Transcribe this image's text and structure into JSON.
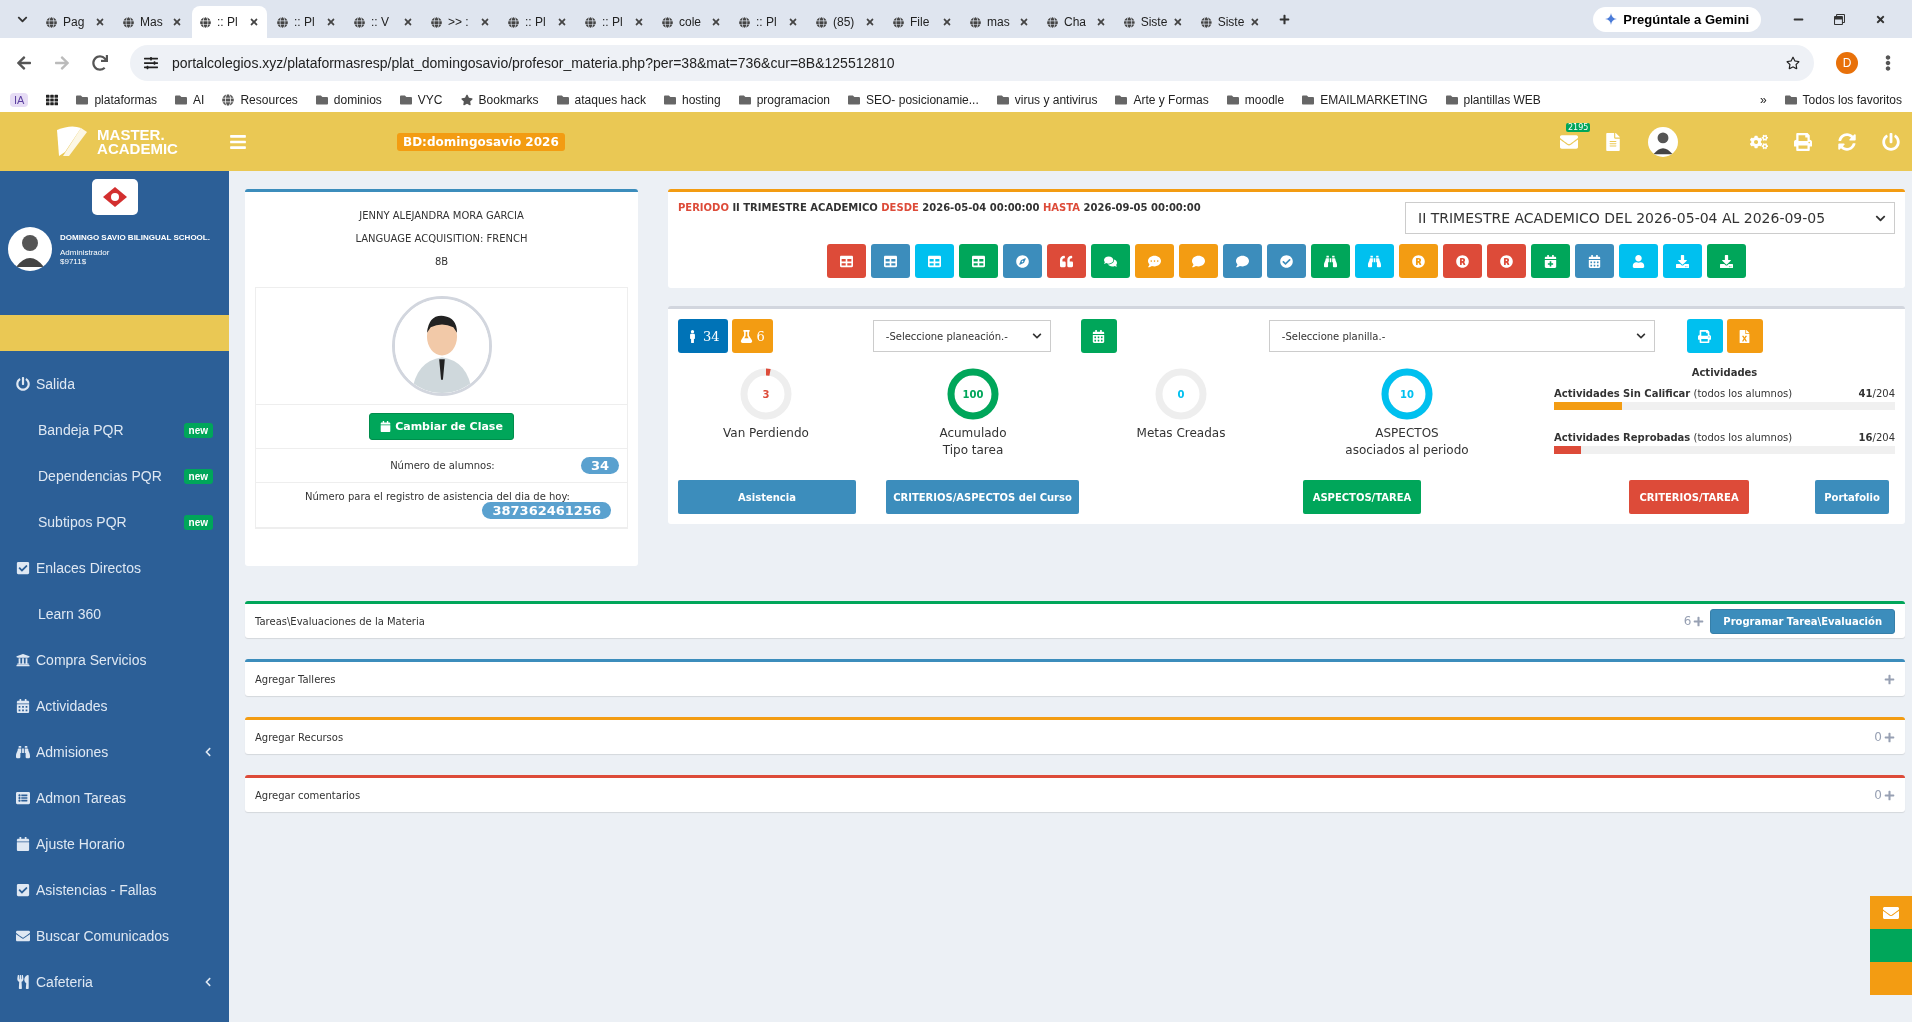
{
  "browser": {
    "tabs": [
      {
        "title": "Pag",
        "selected": false
      },
      {
        "title": "Mas",
        "selected": false
      },
      {
        "title": ":: Pl",
        "selected": true
      },
      {
        "title": ":: Pl",
        "selected": false
      },
      {
        "title": ":: V",
        "selected": false
      },
      {
        "title": ">> :",
        "selected": false
      },
      {
        "title": ":: Pl",
        "selected": false
      },
      {
        "title": ":: Pl",
        "selected": false
      },
      {
        "title": "cole",
        "selected": false
      },
      {
        "title": ":: Pl",
        "selected": false
      },
      {
        "title": "(85)",
        "selected": false
      },
      {
        "title": "File",
        "selected": false
      },
      {
        "title": "mas",
        "selected": false
      },
      {
        "title": "Cha",
        "selected": false
      },
      {
        "title": "Siste",
        "selected": false
      },
      {
        "title": "Siste",
        "selected": false
      }
    ],
    "gemini": "Pregúntale a Gemini",
    "url": "portalcolegios.xyz/plataformasresp/plat_domingosavio/profesor_materia.php?per=38&mat=736&cur=8B&125512810",
    "profile_initial": "D",
    "ia": "IA",
    "bookmarks": [
      {
        "label": "plataformas",
        "kind": "folder"
      },
      {
        "label": "AI",
        "kind": "folder"
      },
      {
        "label": "Resources",
        "kind": "site"
      },
      {
        "label": "dominios",
        "kind": "folder"
      },
      {
        "label": "VYC",
        "kind": "folder"
      },
      {
        "label": "Bookmarks",
        "kind": "star"
      },
      {
        "label": "ataques hack",
        "kind": "folder"
      },
      {
        "label": "hosting",
        "kind": "folder"
      },
      {
        "label": "programacion",
        "kind": "folder"
      },
      {
        "label": "SEO- posicionamie...",
        "kind": "folder"
      },
      {
        "label": "virus y antivirus",
        "kind": "folder"
      },
      {
        "label": "Arte y Formas",
        "kind": "folder"
      },
      {
        "label": "moodle",
        "kind": "folder"
      },
      {
        "label": "EMAILMARKETING",
        "kind": "folder"
      },
      {
        "label": "plantillas WEB",
        "kind": "folder"
      }
    ],
    "more": "»",
    "all_bookmarks": "Todos los favoritos"
  },
  "header": {
    "logo_line1": "MASTER.",
    "logo_line2": "ACADEMIC",
    "database": "BD:domingosavio 2026",
    "mail_count": "2195"
  },
  "sidebar": {
    "school": "DOMINGO SAVIO BILINGUAL SCHOOL.",
    "role": "Administrador",
    "code": "$9711$",
    "items": [
      {
        "label": "Salida"
      },
      {
        "label": "Bandeja PQR",
        "badge": "new"
      },
      {
        "label": "Dependencias PQR",
        "badge": "new"
      },
      {
        "label": "Subtipos PQR",
        "badge": "new"
      },
      {
        "label": "Enlaces Directos"
      },
      {
        "label": "Learn 360"
      },
      {
        "label": "Compra Servicios"
      },
      {
        "label": "Actividades"
      },
      {
        "label": "Admisiones",
        "expandable": true
      },
      {
        "label": "Admon Tareas"
      },
      {
        "label": "Ajuste Horario"
      },
      {
        "label": "Asistencias - Fallas"
      },
      {
        "label": "Buscar Comunicados"
      },
      {
        "label": "Cafeteria",
        "expandable": true
      }
    ]
  },
  "teacher_card": {
    "name": "JENNY ALEJANDRA MORA GARCIA",
    "subject": "LANGUAGE ACQUISITION: FRENCH",
    "group": "8B",
    "change_button": "Cambiar de Clase",
    "students_label": "Número de alumnos:",
    "students": "34",
    "attendance_label": "Número para el registro de asistencia del dia de hoy:",
    "attendance_code": "387362461256"
  },
  "period": {
    "label": "PERIODO",
    "name": "II TRIMESTRE ACADEMICO",
    "from_label": "DESDE",
    "from": "2026-05-04 00:00:00",
    "to_label": "HASTA",
    "to": "2026-09-05 00:00:00",
    "select": "II TRIMESTRE ACADEMICO DEL 2026-05-04 AL 2026-09-05",
    "tools": [
      {
        "color": "#dd4b39"
      },
      {
        "color": "#3c8dbc"
      },
      {
        "color": "#00c0ef"
      },
      {
        "color": "#00a65a"
      },
      {
        "color": "#3c8dbc"
      },
      {
        "color": "#dd4b39"
      },
      {
        "color": "#00a65a"
      },
      {
        "color": "#f39c12"
      },
      {
        "color": "#f39c12"
      },
      {
        "color": "#3c8dbc"
      },
      {
        "color": "#3c8dbc"
      },
      {
        "color": "#00a65a"
      },
      {
        "color": "#00c0ef"
      },
      {
        "color": "#f39c12"
      },
      {
        "color": "#dd4b39"
      },
      {
        "color": "#dd4b39"
      },
      {
        "color": "#00a65a"
      },
      {
        "color": "#3c8dbc"
      },
      {
        "color": "#00c0ef"
      },
      {
        "color": "#00c0ef"
      },
      {
        "color": "#00a65a"
      }
    ]
  },
  "summary": {
    "students_count": "34",
    "labs_count": "6",
    "planning_select": "-Seleccione planeación.-",
    "sheet_select": "-Seleccione planilla.-",
    "gauges": [
      {
        "value": "3",
        "label_lines": [
          "Van Perdiendo"
        ],
        "level": 0.03,
        "color": "#dd4b39"
      },
      {
        "value": "100",
        "label_lines": [
          "Acumulado",
          "Tipo tarea"
        ],
        "level": 1,
        "color": "#00a65a"
      },
      {
        "value": "0",
        "label_lines": [
          "Metas Creadas"
        ],
        "level": 0,
        "color": "#00c0ef"
      },
      {
        "value": "10",
        "label_lines": [
          "ASPECTOS",
          "asociados al periodo"
        ],
        "level": 1,
        "color": "#00c0ef"
      }
    ],
    "activities": {
      "title": "Actividades",
      "bars": [
        {
          "label": "Actividades Sin Calificar",
          "note": "(todos los alumnos)",
          "count": "41",
          "total": "/204",
          "level": 0.2,
          "color": "#f39c12"
        },
        {
          "label": "Actividades Reprobadas",
          "note": "(todos los alumnos)",
          "count": "16",
          "total": "/204",
          "level": 0.078,
          "color": "#dd4b39"
        }
      ]
    },
    "buttons": [
      {
        "label": "Asistencia",
        "color": "#3c8dbc"
      },
      {
        "label": "CRITERIOS/ASPECTOS del Curso",
        "color": "#3c8dbc"
      },
      {
        "label": "ASPECTOS/TAREA",
        "color": "#00a65a"
      },
      {
        "label": "CRITERIOS/TAREA",
        "color": "#dd4b39"
      },
      {
        "label": "Portafolio",
        "color": "#3c8dbc"
      }
    ]
  },
  "sections": [
    {
      "title": "Tareas\\Evaluaciones de la Materia",
      "color": "#00a65a",
      "count": "6",
      "action": "Programar Tarea\\Evaluación"
    },
    {
      "title": "Agregar Talleres",
      "color": "#3c8dbc"
    },
    {
      "title": "Agregar Recursos",
      "color": "#f39c12",
      "count": "0"
    },
    {
      "title": "Agregar comentarios",
      "color": "#dd4b39",
      "count": "0"
    }
  ]
}
